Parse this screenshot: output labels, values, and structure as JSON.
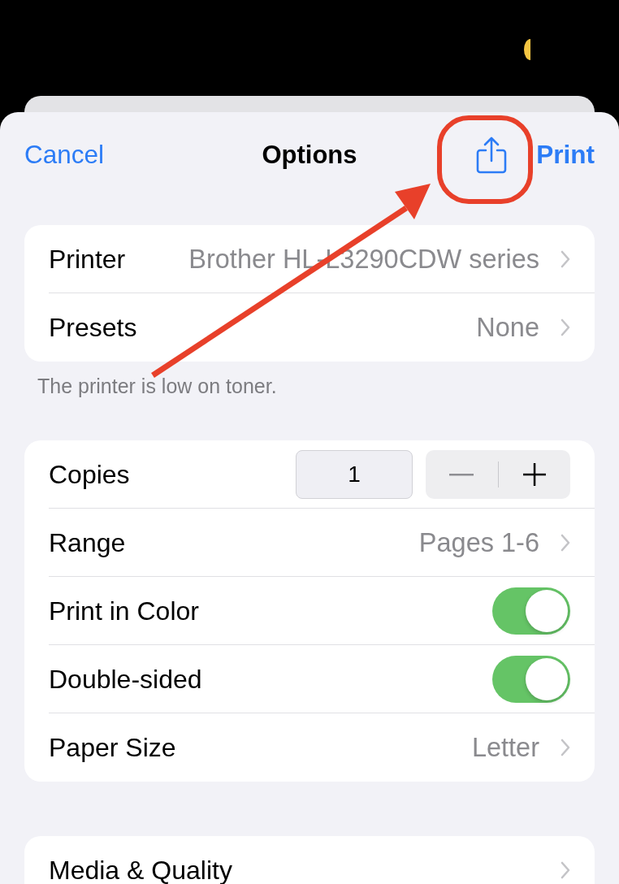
{
  "nav": {
    "cancel": "Cancel",
    "title": "Options",
    "print": "Print"
  },
  "groups": [
    {
      "rows": [
        {
          "kind": "value",
          "label": "Printer",
          "value": "Brother HL-L3290CDW series"
        },
        {
          "kind": "value",
          "label": "Presets",
          "value": "None"
        }
      ],
      "footer": "The printer is low on toner."
    },
    {
      "rows": [
        {
          "kind": "stepper",
          "label": "Copies",
          "value": "1"
        },
        {
          "kind": "value",
          "label": "Range",
          "value": "Pages 1-6"
        },
        {
          "kind": "toggle",
          "label": "Print in Color",
          "on": true
        },
        {
          "kind": "toggle",
          "label": "Double-sided",
          "on": true
        },
        {
          "kind": "value",
          "label": "Paper Size",
          "value": "Letter"
        }
      ]
    },
    {
      "rows": [
        {
          "kind": "link",
          "label": "Media & Quality"
        }
      ]
    }
  ]
}
